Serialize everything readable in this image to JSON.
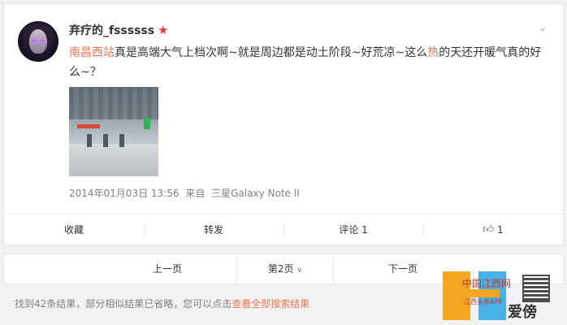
{
  "post": {
    "username": "弃疗的_fssssss",
    "content_parts": {
      "link_place": "南昌西站",
      "text1": "真是高端大气上档次啊~就是周边都是动土阶段~好荒凉~这么",
      "hot": "热",
      "text2": "的天还开暖气真的好么~？"
    },
    "timestamp": "2014年01月03日 13:56",
    "source_prefix": "来自",
    "source": "三星Galaxy Note II"
  },
  "actions": {
    "favorite": "收藏",
    "repost": "转发",
    "comment": "评论 1",
    "like_count": "1"
  },
  "pager": {
    "prev": "上一页",
    "current": "第2页",
    "next": "下一页"
  },
  "notice": {
    "text": "找到42条结果，部分相似结果已省略，您可以点击",
    "link": "查看全部搜索结果"
  },
  "watermark": {
    "cn": "中国江西网",
    "sub": "江西头条APP",
    "ai": "爱傍"
  },
  "colors": {
    "accent": "#eb7350",
    "star": "#e4393c"
  }
}
